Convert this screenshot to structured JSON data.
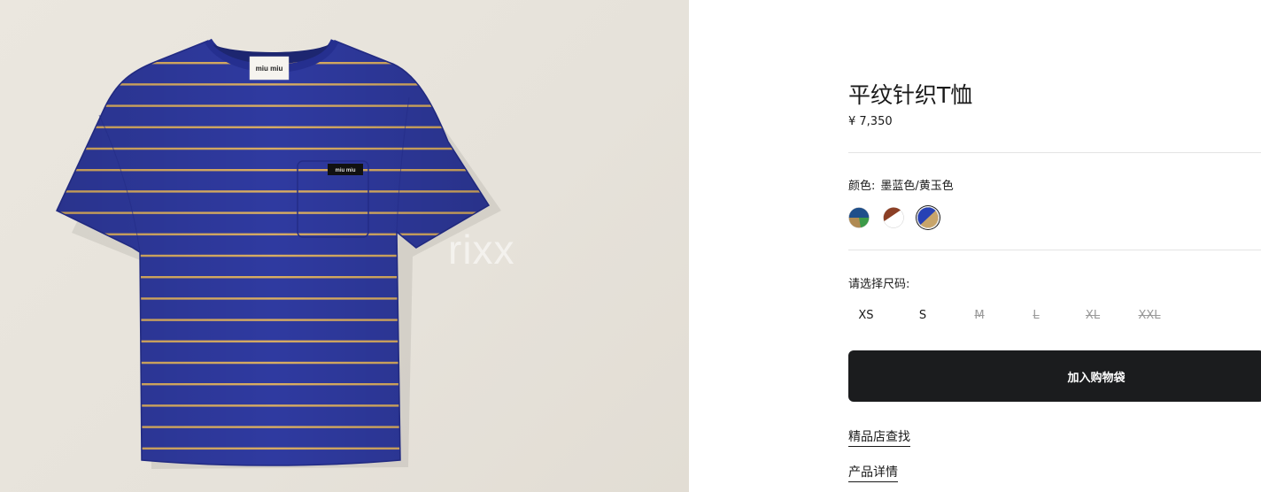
{
  "product": {
    "name": "平纹针织T恤",
    "price": "¥ 7,350",
    "watermark": "rixx",
    "label_text": "miu miu",
    "pocket_badge_text": "miu miu"
  },
  "color": {
    "label": "颜色:",
    "selected_value": "墨蓝色/黄玉色",
    "swatches": [
      {
        "name": "blue-green-brown",
        "colors": [
          "#1f4f8a",
          "#3c9a48",
          "#b08a52"
        ],
        "selected": false
      },
      {
        "name": "brown-white",
        "colors": [
          "#8b3f25",
          "#ffffff"
        ],
        "selected": false
      },
      {
        "name": "navy-topaz",
        "colors": [
          "#2741b5",
          "#c8a56a"
        ],
        "selected": true
      }
    ]
  },
  "size": {
    "label": "请选择尺码:",
    "options": [
      {
        "label": "XS",
        "available": true
      },
      {
        "label": "S",
        "available": true
      },
      {
        "label": "M",
        "available": false
      },
      {
        "label": "L",
        "available": false
      },
      {
        "label": "XL",
        "available": false
      },
      {
        "label": "XXL",
        "available": false
      }
    ]
  },
  "actions": {
    "add_to_bag": "加入购物袋",
    "store_locator": "精品店查找",
    "product_details": "产品详情"
  },
  "colors": {
    "shirt_blue": "#2f3aa0",
    "stripe_gold": "#d9ad62",
    "button_bg": "#1b1c1e"
  }
}
